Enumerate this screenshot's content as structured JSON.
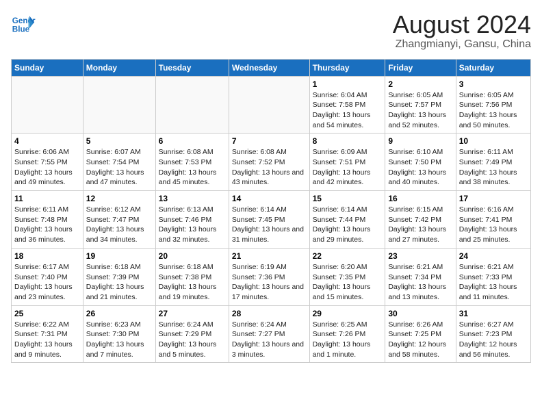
{
  "header": {
    "logo_line1": "General",
    "logo_line2": "Blue",
    "title": "August 2024",
    "subtitle": "Zhangmianyi, Gansu, China"
  },
  "days_of_week": [
    "Sunday",
    "Monday",
    "Tuesday",
    "Wednesday",
    "Thursday",
    "Friday",
    "Saturday"
  ],
  "weeks": [
    [
      {
        "day": "",
        "empty": true
      },
      {
        "day": "",
        "empty": true
      },
      {
        "day": "",
        "empty": true
      },
      {
        "day": "",
        "empty": true
      },
      {
        "day": "1",
        "sunrise": "6:04 AM",
        "sunset": "7:58 PM",
        "daylight": "13 hours and 54 minutes."
      },
      {
        "day": "2",
        "sunrise": "6:05 AM",
        "sunset": "7:57 PM",
        "daylight": "13 hours and 52 minutes."
      },
      {
        "day": "3",
        "sunrise": "6:05 AM",
        "sunset": "7:56 PM",
        "daylight": "13 hours and 50 minutes."
      }
    ],
    [
      {
        "day": "4",
        "sunrise": "6:06 AM",
        "sunset": "7:55 PM",
        "daylight": "13 hours and 49 minutes."
      },
      {
        "day": "5",
        "sunrise": "6:07 AM",
        "sunset": "7:54 PM",
        "daylight": "13 hours and 47 minutes."
      },
      {
        "day": "6",
        "sunrise": "6:08 AM",
        "sunset": "7:53 PM",
        "daylight": "13 hours and 45 minutes."
      },
      {
        "day": "7",
        "sunrise": "6:08 AM",
        "sunset": "7:52 PM",
        "daylight": "13 hours and 43 minutes."
      },
      {
        "day": "8",
        "sunrise": "6:09 AM",
        "sunset": "7:51 PM",
        "daylight": "13 hours and 42 minutes."
      },
      {
        "day": "9",
        "sunrise": "6:10 AM",
        "sunset": "7:50 PM",
        "daylight": "13 hours and 40 minutes."
      },
      {
        "day": "10",
        "sunrise": "6:11 AM",
        "sunset": "7:49 PM",
        "daylight": "13 hours and 38 minutes."
      }
    ],
    [
      {
        "day": "11",
        "sunrise": "6:11 AM",
        "sunset": "7:48 PM",
        "daylight": "13 hours and 36 minutes."
      },
      {
        "day": "12",
        "sunrise": "6:12 AM",
        "sunset": "7:47 PM",
        "daylight": "13 hours and 34 minutes."
      },
      {
        "day": "13",
        "sunrise": "6:13 AM",
        "sunset": "7:46 PM",
        "daylight": "13 hours and 32 minutes."
      },
      {
        "day": "14",
        "sunrise": "6:14 AM",
        "sunset": "7:45 PM",
        "daylight": "13 hours and 31 minutes."
      },
      {
        "day": "15",
        "sunrise": "6:14 AM",
        "sunset": "7:44 PM",
        "daylight": "13 hours and 29 minutes."
      },
      {
        "day": "16",
        "sunrise": "6:15 AM",
        "sunset": "7:42 PM",
        "daylight": "13 hours and 27 minutes."
      },
      {
        "day": "17",
        "sunrise": "6:16 AM",
        "sunset": "7:41 PM",
        "daylight": "13 hours and 25 minutes."
      }
    ],
    [
      {
        "day": "18",
        "sunrise": "6:17 AM",
        "sunset": "7:40 PM",
        "daylight": "13 hours and 23 minutes."
      },
      {
        "day": "19",
        "sunrise": "6:18 AM",
        "sunset": "7:39 PM",
        "daylight": "13 hours and 21 minutes."
      },
      {
        "day": "20",
        "sunrise": "6:18 AM",
        "sunset": "7:38 PM",
        "daylight": "13 hours and 19 minutes."
      },
      {
        "day": "21",
        "sunrise": "6:19 AM",
        "sunset": "7:36 PM",
        "daylight": "13 hours and 17 minutes."
      },
      {
        "day": "22",
        "sunrise": "6:20 AM",
        "sunset": "7:35 PM",
        "daylight": "13 hours and 15 minutes."
      },
      {
        "day": "23",
        "sunrise": "6:21 AM",
        "sunset": "7:34 PM",
        "daylight": "13 hours and 13 minutes."
      },
      {
        "day": "24",
        "sunrise": "6:21 AM",
        "sunset": "7:33 PM",
        "daylight": "13 hours and 11 minutes."
      }
    ],
    [
      {
        "day": "25",
        "sunrise": "6:22 AM",
        "sunset": "7:31 PM",
        "daylight": "13 hours and 9 minutes."
      },
      {
        "day": "26",
        "sunrise": "6:23 AM",
        "sunset": "7:30 PM",
        "daylight": "13 hours and 7 minutes."
      },
      {
        "day": "27",
        "sunrise": "6:24 AM",
        "sunset": "7:29 PM",
        "daylight": "13 hours and 5 minutes."
      },
      {
        "day": "28",
        "sunrise": "6:24 AM",
        "sunset": "7:27 PM",
        "daylight": "13 hours and 3 minutes."
      },
      {
        "day": "29",
        "sunrise": "6:25 AM",
        "sunset": "7:26 PM",
        "daylight": "13 hours and 1 minute."
      },
      {
        "day": "30",
        "sunrise": "6:26 AM",
        "sunset": "7:25 PM",
        "daylight": "12 hours and 58 minutes."
      },
      {
        "day": "31",
        "sunrise": "6:27 AM",
        "sunset": "7:23 PM",
        "daylight": "12 hours and 56 minutes."
      }
    ]
  ],
  "labels": {
    "sunrise": "Sunrise:",
    "sunset": "Sunset:",
    "daylight": "Daylight:"
  }
}
